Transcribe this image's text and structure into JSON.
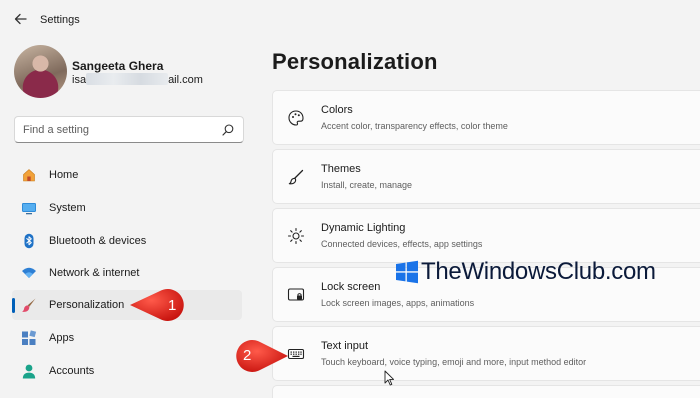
{
  "window": {
    "title": "Settings"
  },
  "user": {
    "name": "Sangeeta Ghera",
    "email_prefix": "isa",
    "email_suffix": "ail.com"
  },
  "search": {
    "placeholder": "Find a setting"
  },
  "nav": {
    "items": [
      {
        "label": "Home",
        "icon": "home-icon"
      },
      {
        "label": "System",
        "icon": "system-display-icon"
      },
      {
        "label": "Bluetooth & devices",
        "icon": "bluetooth-icon"
      },
      {
        "label": "Network & internet",
        "icon": "wifi-icon"
      },
      {
        "label": "Personalization",
        "icon": "paintbrush-icon",
        "selected": true
      },
      {
        "label": "Apps",
        "icon": "apps-icon"
      },
      {
        "label": "Accounts",
        "icon": "account-icon"
      }
    ]
  },
  "main": {
    "title": "Personalization",
    "cards": [
      {
        "title": "Colors",
        "description": "Accent color, transparency effects, color theme",
        "icon": "palette-icon"
      },
      {
        "title": "Themes",
        "description": "Install, create, manage",
        "icon": "brush-icon"
      },
      {
        "title": "Dynamic Lighting",
        "description": "Connected devices, effects, app settings",
        "icon": "sun-lighting-icon"
      },
      {
        "title": "Lock screen",
        "description": "Lock screen images, apps, animations",
        "icon": "lock-screen-icon"
      },
      {
        "title": "Text input",
        "description": "Touch keyboard, voice typing, emoji and more, input method editor",
        "icon": "keyboard-icon"
      }
    ]
  },
  "annotations": {
    "step1": "1",
    "step2": "2"
  },
  "watermark": {
    "text": "TheWindowsClub.com"
  },
  "colors": {
    "accent": "#005fb8",
    "callout": "#e0201b"
  }
}
